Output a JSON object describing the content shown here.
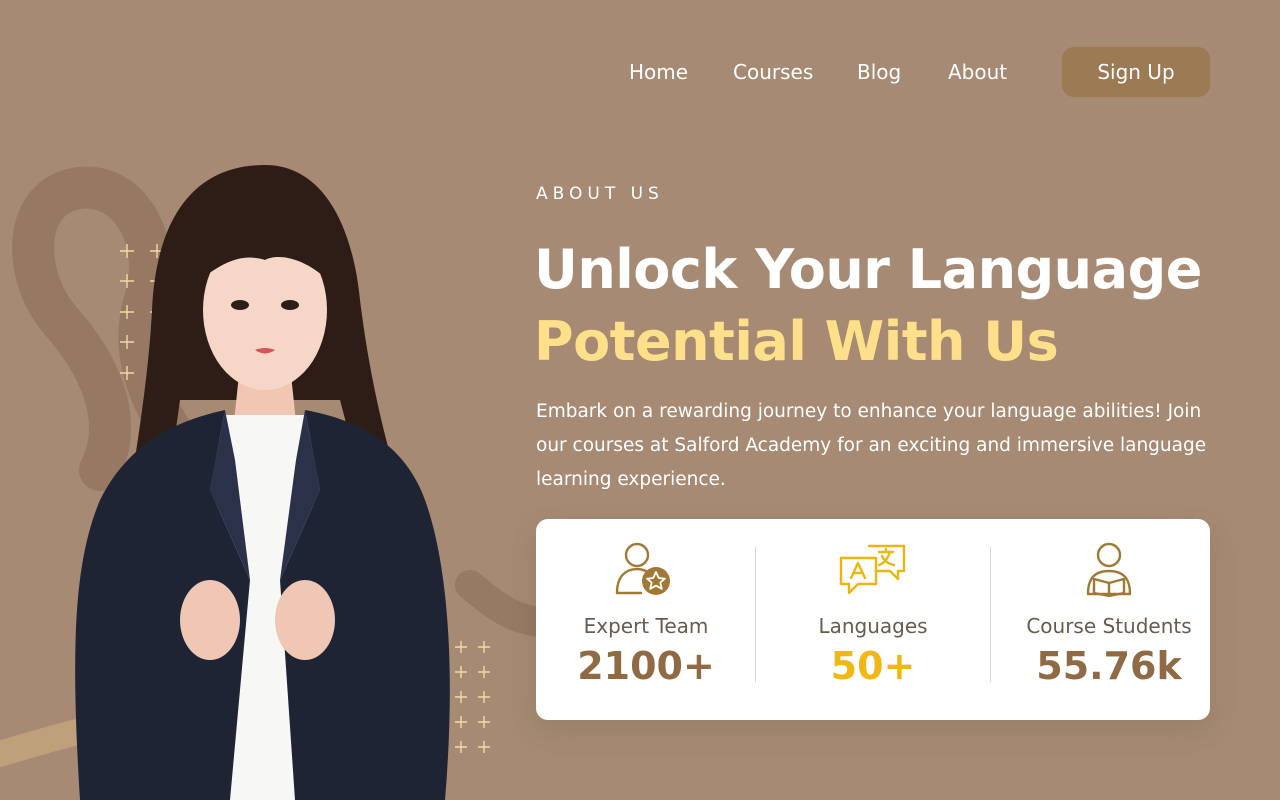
{
  "nav": {
    "links": [
      "Home",
      "Courses",
      "Blog",
      "About"
    ],
    "signup_label": "Sign Up"
  },
  "hero": {
    "eyebrow": "ABOUT US",
    "title_line1": "Unlock Your Language",
    "title_line2": "Potential With Us",
    "description": "Embark on a rewarding journey to enhance your language abilities! Join our courses at Salford Academy for an exciting and immersive language learning experience."
  },
  "stats": [
    {
      "label": "Expert Team",
      "value": "2100+",
      "icon": "user-star-icon",
      "value_color": "#8f6a45"
    },
    {
      "label": "Languages",
      "value": "50+",
      "icon": "translate-chat-icon",
      "value_color": "#f0b814"
    },
    {
      "label": "Course Students",
      "value": "55.76k",
      "icon": "student-reading-icon",
      "value_color": "#8f6a45"
    }
  ],
  "colors": {
    "background": "#a68a73",
    "button": "#9b7a54",
    "highlight": "#ffe08a",
    "card": "#ffffff",
    "icon": "#a27837"
  }
}
